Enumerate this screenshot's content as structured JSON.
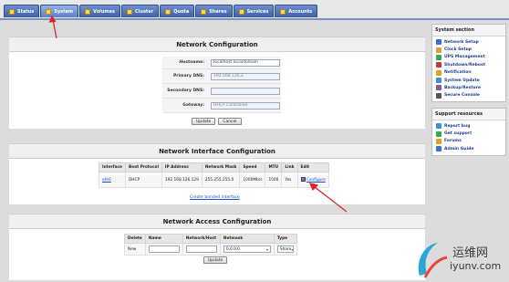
{
  "nav": {
    "tabs": [
      {
        "label": "Status",
        "icon": "monitor-icon"
      },
      {
        "label": "System",
        "icon": "system-icon",
        "active": true
      },
      {
        "label": "Volumes",
        "icon": "disk-icon"
      },
      {
        "label": "Cluster",
        "icon": "cluster-icon"
      },
      {
        "label": "Quota",
        "icon": "quota-icon"
      },
      {
        "label": "Shares",
        "icon": "folder-icon"
      },
      {
        "label": "Services",
        "icon": "services-icon"
      },
      {
        "label": "Accounts",
        "icon": "users-icon"
      }
    ]
  },
  "network_config": {
    "title": "Network Configuration",
    "hostname_label": "Hostname:",
    "hostname_value": "localhost.localdomain",
    "primary_dns_label": "Primary DNS:",
    "primary_dns_value": "192.168.126.2",
    "secondary_dns_label": "Secondary DNS:",
    "secondary_dns_value": "",
    "gateway_label": "Gateway:",
    "gateway_value": "DHCP Controlled",
    "update_label": "Update",
    "cancel_label": "Cancel"
  },
  "interface_config": {
    "title": "Network Interface Configuration",
    "headers": [
      "Interface",
      "Boot Protocol",
      "IP Address",
      "Network Mask",
      "Speed",
      "MTU",
      "Link",
      "Edit"
    ],
    "row": {
      "interface": "eth0",
      "boot_protocol": "DHCP",
      "ip": "192.168.126.129",
      "mask": "255.255.255.0",
      "speed": "1000Mb/s",
      "mtu": "1500",
      "link": "Yes",
      "edit": "Configure"
    },
    "create_bonded": "Create bonded interface"
  },
  "access_config": {
    "title": "Network Access Configuration",
    "headers": [
      "Delete",
      "Name",
      "Network/Host",
      "Netmask",
      "Type"
    ],
    "row": {
      "delete": "New",
      "name": "",
      "network": "",
      "netmask": "0.0.0.0",
      "type": "Share"
    },
    "update_label": "Update"
  },
  "sidebar": {
    "system_title": "System section",
    "system_items": [
      {
        "label": "Network Setup",
        "color": "#3c6fd6"
      },
      {
        "label": "Clock Setup",
        "color": "#d6a13c"
      },
      {
        "label": "UPS Management",
        "color": "#3ca84c"
      },
      {
        "label": "Shutdown/Reboot",
        "color": "#c43a3a"
      },
      {
        "label": "Notification",
        "color": "#e0a020"
      },
      {
        "label": "System Update",
        "color": "#3c8fd6"
      },
      {
        "label": "Backup/Restore",
        "color": "#7b5bb5"
      },
      {
        "label": "Secure Console",
        "color": "#555555"
      }
    ],
    "support_title": "Support resources",
    "support_items": [
      {
        "label": "Report bug",
        "color": "#3c8fd6"
      },
      {
        "label": "Get support",
        "color": "#3ca84c"
      },
      {
        "label": "Forums",
        "color": "#e0a020"
      },
      {
        "label": "Admin Guide",
        "color": "#3c6fd6"
      }
    ]
  },
  "watermark": {
    "cn_text": "运维网",
    "url_text": "iyunv.com"
  },
  "colors": {
    "annotation_red": "#e02020",
    "tab_blue": "#3e5fa6",
    "link_blue": "#1a4fc9"
  }
}
